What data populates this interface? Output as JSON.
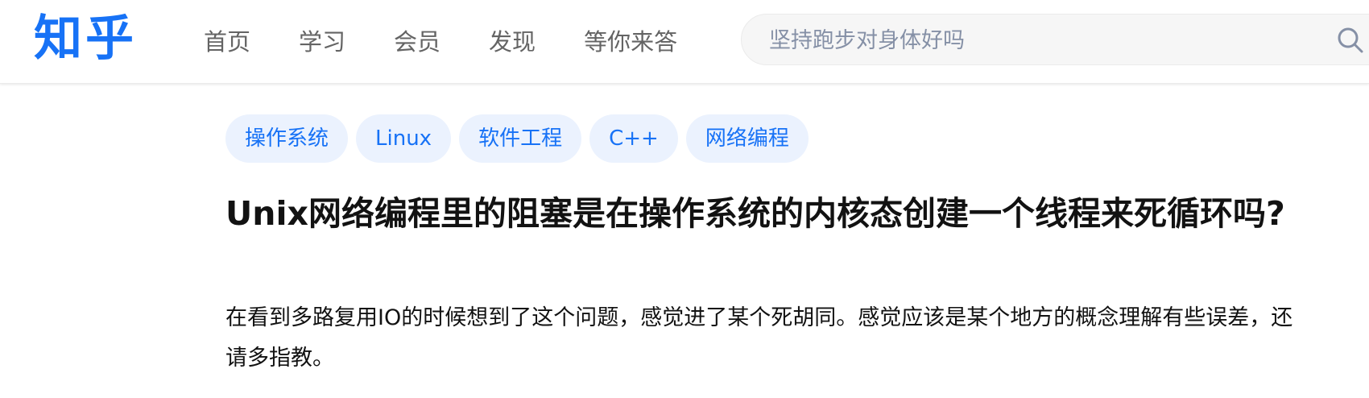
{
  "header": {
    "logo": "知乎",
    "nav": [
      "首页",
      "学习",
      "会员",
      "发现",
      "等你来答"
    ],
    "search": {
      "placeholder": "坚持跑步对身体好吗",
      "icon": "search-icon"
    }
  },
  "question": {
    "topics": [
      "操作系统",
      "Linux",
      "软件工程",
      "C++",
      "网络编程"
    ],
    "title": "Unix网络编程里的阻塞是在操作系统的内核态创建一个线程来死循环吗?",
    "detail": "在看到多路复用IO的时候想到了这个问题，感觉进了某个死胡同。感觉应该是某个地方的概念理解有些误差，还请多指教。"
  },
  "colors": {
    "brand": "#1772f6",
    "tag_background": "#ebf2fe",
    "nav_text": "#646464",
    "title_text": "#121212"
  }
}
